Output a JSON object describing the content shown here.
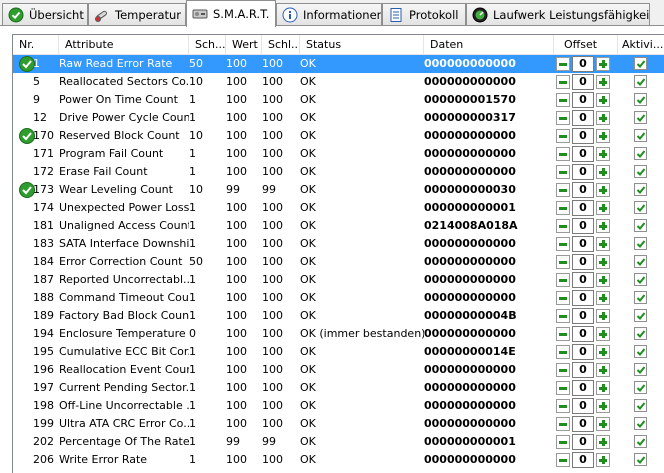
{
  "tabs": [
    {
      "label": "Übersicht",
      "icon": "green-check-icon",
      "active": false
    },
    {
      "label": "Temperatur",
      "icon": "thermometer-icon",
      "active": false
    },
    {
      "label": "S.M.A.R.T.",
      "icon": "hard-drive-icon",
      "active": true
    },
    {
      "label": "Informationen",
      "icon": "info-icon",
      "active": false
    },
    {
      "label": "Protokoll",
      "icon": "document-icon",
      "active": false
    },
    {
      "label": "Laufwerk Leistungsfähigkeit",
      "icon": "gauge-icon",
      "active": false
    }
  ],
  "columns": {
    "nr": "Nr.",
    "attr": "Attribute",
    "sch": "Sch...",
    "wert": "Wert",
    "schl": "Schl...",
    "status": "Status",
    "daten": "Daten",
    "offset": "Offset",
    "akt": "Aktivi..."
  },
  "rows": [
    {
      "nr": "1",
      "attr": "Raw Read Error Rate",
      "sch": "50",
      "wert": "100",
      "schl": "100",
      "status": "OK",
      "daten": "000000000000",
      "offset": "0",
      "ok_icon": true,
      "selected": true
    },
    {
      "nr": "5",
      "attr": "Reallocated Sectors Co...",
      "sch": "10",
      "wert": "100",
      "schl": "100",
      "status": "OK",
      "daten": "000000000000",
      "offset": "0",
      "ok_icon": false
    },
    {
      "nr": "9",
      "attr": "Power On Time Count",
      "sch": "1",
      "wert": "100",
      "schl": "100",
      "status": "OK",
      "daten": "000000001570",
      "offset": "0",
      "ok_icon": false
    },
    {
      "nr": "12",
      "attr": "Drive Power Cycle Count",
      "sch": "1",
      "wert": "100",
      "schl": "100",
      "status": "OK",
      "daten": "000000000317",
      "offset": "0",
      "ok_icon": false
    },
    {
      "nr": "170",
      "attr": "Reserved Block Count",
      "sch": "10",
      "wert": "100",
      "schl": "100",
      "status": "OK",
      "daten": "000000000000",
      "offset": "0",
      "ok_icon": true
    },
    {
      "nr": "171",
      "attr": "Program Fail Count",
      "sch": "1",
      "wert": "100",
      "schl": "100",
      "status": "OK",
      "daten": "000000000000",
      "offset": "0",
      "ok_icon": false
    },
    {
      "nr": "172",
      "attr": "Erase Fail Count",
      "sch": "1",
      "wert": "100",
      "schl": "100",
      "status": "OK",
      "daten": "000000000000",
      "offset": "0",
      "ok_icon": false
    },
    {
      "nr": "173",
      "attr": "Wear Leveling Count",
      "sch": "10",
      "wert": "99",
      "schl": "99",
      "status": "OK",
      "daten": "000000000030",
      "offset": "0",
      "ok_icon": true
    },
    {
      "nr": "174",
      "attr": "Unexpected Power Loss...",
      "sch": "1",
      "wert": "100",
      "schl": "100",
      "status": "OK",
      "daten": "000000000001",
      "offset": "0",
      "ok_icon": false
    },
    {
      "nr": "181",
      "attr": "Unaligned Access Count",
      "sch": "1",
      "wert": "100",
      "schl": "100",
      "status": "OK",
      "daten": "0214008A018A",
      "offset": "0",
      "ok_icon": false
    },
    {
      "nr": "183",
      "attr": "SATA Interface Downshift",
      "sch": "1",
      "wert": "100",
      "schl": "100",
      "status": "OK",
      "daten": "000000000000",
      "offset": "0",
      "ok_icon": false
    },
    {
      "nr": "184",
      "attr": "Error Correction Count",
      "sch": "50",
      "wert": "100",
      "schl": "100",
      "status": "OK",
      "daten": "000000000000",
      "offset": "0",
      "ok_icon": false
    },
    {
      "nr": "187",
      "attr": "Reported Uncorrectabl...",
      "sch": "1",
      "wert": "100",
      "schl": "100",
      "status": "OK",
      "daten": "000000000000",
      "offset": "0",
      "ok_icon": false
    },
    {
      "nr": "188",
      "attr": "Command Timeout Cou...",
      "sch": "1",
      "wert": "100",
      "schl": "100",
      "status": "OK",
      "daten": "000000000000",
      "offset": "0",
      "ok_icon": false
    },
    {
      "nr": "189",
      "attr": "Factory Bad Block Count",
      "sch": "1",
      "wert": "100",
      "schl": "100",
      "status": "OK",
      "daten": "00000000004B",
      "offset": "0",
      "ok_icon": false
    },
    {
      "nr": "194",
      "attr": "Enclosure Temperature",
      "sch": "0",
      "wert": "100",
      "schl": "100",
      "status": "OK (immer bestanden)",
      "daten": "000000000000",
      "offset": "0",
      "ok_icon": false
    },
    {
      "nr": "195",
      "attr": "Cumulative ECC Bit Cor...",
      "sch": "1",
      "wert": "100",
      "schl": "100",
      "status": "OK",
      "daten": "00000000014E",
      "offset": "0",
      "ok_icon": false
    },
    {
      "nr": "196",
      "attr": "Reallocation Event Count",
      "sch": "1",
      "wert": "100",
      "schl": "100",
      "status": "OK",
      "daten": "000000000000",
      "offset": "0",
      "ok_icon": false
    },
    {
      "nr": "197",
      "attr": "Current Pending Sector...",
      "sch": "1",
      "wert": "100",
      "schl": "100",
      "status": "OK",
      "daten": "000000000000",
      "offset": "0",
      "ok_icon": false
    },
    {
      "nr": "198",
      "attr": "Off-Line Uncorrectable ...",
      "sch": "1",
      "wert": "100",
      "schl": "100",
      "status": "OK",
      "daten": "000000000000",
      "offset": "0",
      "ok_icon": false
    },
    {
      "nr": "199",
      "attr": "Ultra ATA CRC Error Co...",
      "sch": "1",
      "wert": "100",
      "schl": "100",
      "status": "OK",
      "daten": "000000000000",
      "offset": "0",
      "ok_icon": false
    },
    {
      "nr": "202",
      "attr": "Percentage Of The Rate...",
      "sch": "1",
      "wert": "99",
      "schl": "99",
      "status": "OK",
      "daten": "000000000001",
      "offset": "0",
      "ok_icon": false
    },
    {
      "nr": "206",
      "attr": "Write Error Rate",
      "sch": "1",
      "wert": "100",
      "schl": "100",
      "status": "OK",
      "daten": "000000000000",
      "offset": "0",
      "ok_icon": false
    }
  ],
  "colors": {
    "selection": "#3399ff",
    "ok_green": "#2e9d2e",
    "alt_row": "#f2f2f2"
  }
}
